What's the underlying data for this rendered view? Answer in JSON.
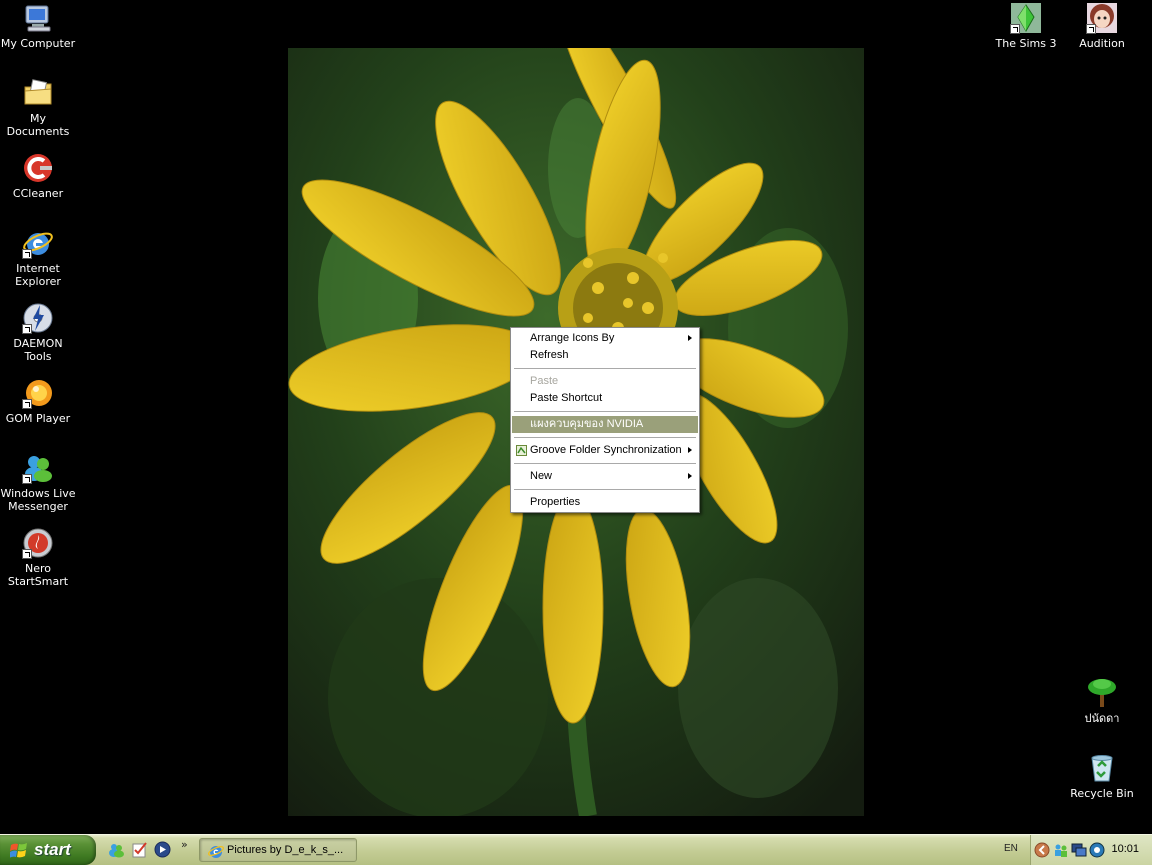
{
  "desktop_icons_left": [
    {
      "name": "my-computer",
      "label": "My Computer"
    },
    {
      "name": "my-documents",
      "label": "My Documents"
    },
    {
      "name": "ccleaner",
      "label": "CCleaner"
    },
    {
      "name": "internet-explorer",
      "label": "Internet Explorer"
    },
    {
      "name": "daemon-tools",
      "label": "DAEMON Tools"
    },
    {
      "name": "gom-player",
      "label": "GOM Player"
    },
    {
      "name": "windows-live-messenger",
      "label": "Windows Live Messenger"
    },
    {
      "name": "nero-startsmart",
      "label": "Nero StartSmart"
    }
  ],
  "desktop_icons_right": [
    {
      "name": "the-sims-3",
      "label": "The Sims 3"
    },
    {
      "name": "audition",
      "label": "Audition"
    },
    {
      "name": "tree-folder",
      "label": "ปนัดดา"
    },
    {
      "name": "recycle-bin",
      "label": "Recycle Bin"
    }
  ],
  "context_menu": {
    "items": [
      {
        "label": "Arrange Icons By",
        "submenu": true
      },
      {
        "label": "Refresh"
      },
      {
        "label": "Paste",
        "disabled": true
      },
      {
        "label": "Paste Shortcut"
      },
      {
        "label": "แผงควบคุมของ NVIDIA",
        "highlighted": true
      },
      {
        "label": "Groove Folder Synchronization",
        "submenu": true
      },
      {
        "label": "New",
        "submenu": true
      },
      {
        "label": "Properties"
      }
    ]
  },
  "taskbar": {
    "start_label": "start",
    "more_quicklaunch": "»",
    "window_button": "Pictures by D_e_k_s_...",
    "language": "EN",
    "clock": "10:01"
  },
  "colors": {
    "menu_highlight": "#9aa07a",
    "taskbar": "#c3cc94",
    "start_button": "#3f7a22",
    "flower_yellow": "#e3c21a"
  }
}
